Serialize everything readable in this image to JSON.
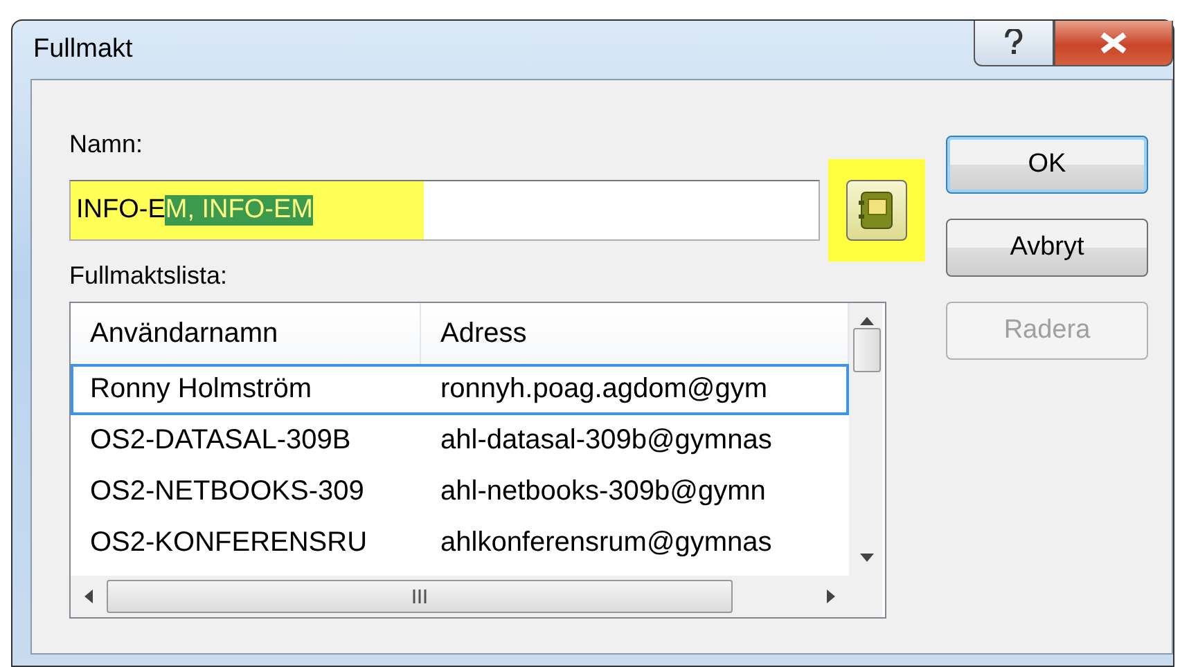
{
  "window": {
    "title": "Fullmakt"
  },
  "name_field": {
    "label": "Namn:",
    "highlighted": true,
    "value_parts": [
      {
        "text": "INFO-E",
        "selected": false
      },
      {
        "text": "M, INFO-EM",
        "selected": true
      }
    ]
  },
  "address_book_button": {
    "highlighted": true
  },
  "list": {
    "label": "Fullmaktslista:",
    "columns": [
      "Användarnamn",
      "Adress"
    ],
    "rows": [
      {
        "cells": [
          "Ronny Holmström",
          "ronnyh.poag.agdom@gym"
        ],
        "selected": true
      },
      {
        "cells": [
          "OS2-DATASAL-309B",
          "ahl-datasal-309b@gymnas"
        ],
        "selected": false
      },
      {
        "cells": [
          "OS2-NETBOOKS-309",
          "ahl-netbooks-309b@gymn"
        ],
        "selected": false
      },
      {
        "cells": [
          "OS2-KONFERENSRU",
          "ahlkonferensrum@gymnas"
        ],
        "selected": false
      }
    ]
  },
  "buttons": [
    {
      "label": "OK",
      "default": true,
      "disabled": false
    },
    {
      "label": "Avbryt",
      "default": false,
      "disabled": false
    },
    {
      "label": "Radera",
      "default": false,
      "disabled": true
    }
  ]
}
